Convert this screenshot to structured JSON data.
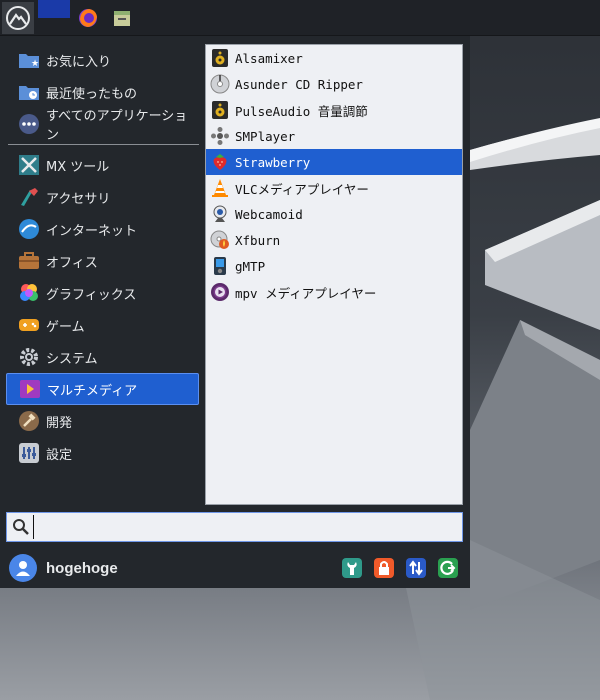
{
  "categories": [
    {
      "label": "お気に入り",
      "icon": "favorites-folder-icon"
    },
    {
      "label": "最近使ったもの",
      "icon": "recent-folder-icon"
    },
    {
      "label": "すべてのアプリケーション",
      "icon": "all-apps-icon"
    },
    {
      "label": "MX ツール",
      "icon": "mx-tools-icon"
    },
    {
      "label": "アクセサリ",
      "icon": "accessories-icon"
    },
    {
      "label": "インターネット",
      "icon": "internet-icon"
    },
    {
      "label": "オフィス",
      "icon": "office-icon"
    },
    {
      "label": "グラフィックス",
      "icon": "graphics-icon"
    },
    {
      "label": "ゲーム",
      "icon": "games-icon"
    },
    {
      "label": "システム",
      "icon": "system-icon"
    },
    {
      "label": "マルチメディア",
      "icon": "multimedia-icon"
    },
    {
      "label": "開発",
      "icon": "development-icon"
    },
    {
      "label": "設定",
      "icon": "settings-icon"
    }
  ],
  "selected_category": "マルチメディア",
  "apps": [
    {
      "label": "Alsamixer",
      "icon": "speaker-icon"
    },
    {
      "label": "Asunder CD Ripper",
      "icon": "cd-icon"
    },
    {
      "label": "PulseAudio 音量調節",
      "icon": "speaker-icon"
    },
    {
      "label": "SMPlayer",
      "icon": "smplayer-icon"
    },
    {
      "label": "Strawberry",
      "icon": "strawberry-icon"
    },
    {
      "label": "VLCメディアプレイヤー",
      "icon": "vlc-cone-icon"
    },
    {
      "label": "Webcamoid",
      "icon": "webcam-icon"
    },
    {
      "label": "Xfburn",
      "icon": "xfburn-disc-icon"
    },
    {
      "label": "gMTP",
      "icon": "media-player-device-icon"
    },
    {
      "label": "mpv メディアプレイヤー",
      "icon": "mpv-icon"
    }
  ],
  "selected_app": "Strawberry",
  "search": {
    "value": "",
    "placeholder": ""
  },
  "user": {
    "name": "hogehoge"
  },
  "colors": {
    "accent": "#1f5fd0",
    "panel": "#23272c"
  }
}
